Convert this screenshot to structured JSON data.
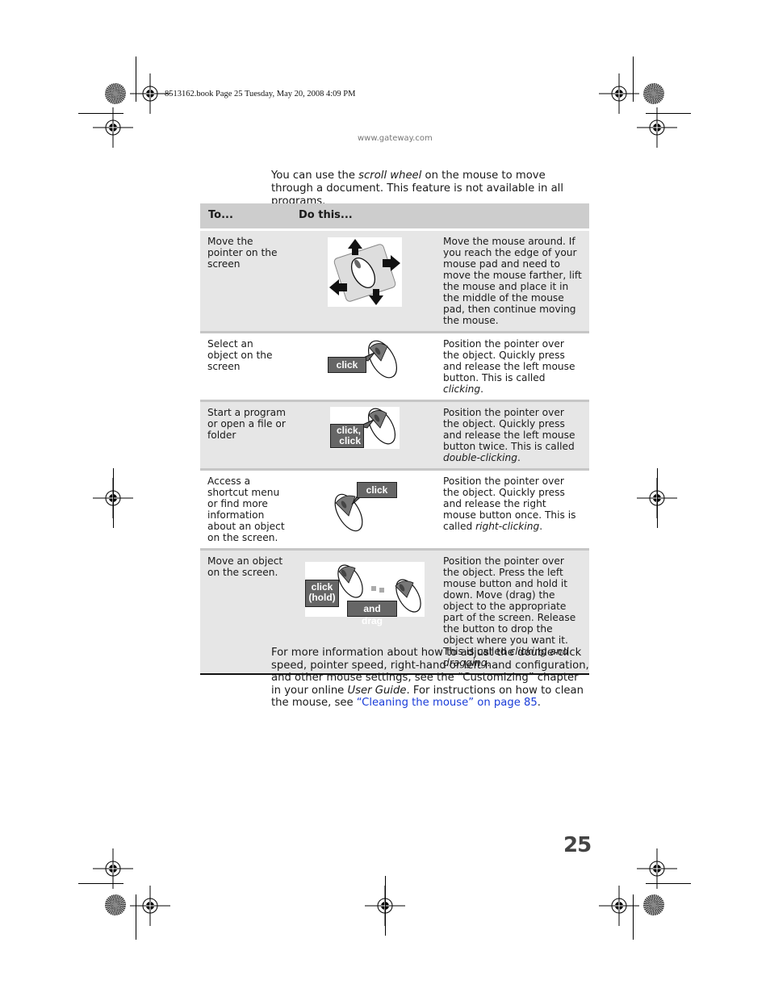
{
  "header": {
    "slug": "8513162.book  Page 25  Tuesday, May 20, 2008  4:09 PM",
    "website": "www.gateway.com"
  },
  "intro": {
    "before": "You can use the ",
    "emphasis": "scroll wheel",
    "after": " on the mouse to move through a document. This feature is not available in all programs."
  },
  "table": {
    "headers": [
      "To...",
      "Do this..."
    ],
    "rows": [
      {
        "to": "Move the pointer on the screen",
        "illustration": "mouse-on-pad-with-arrows",
        "desc_before": "Move the mouse around. If you reach the edge of your mouse pad and need to move the mouse farther, lift the mouse and place it in the middle of the mouse pad, then continue moving the mouse.",
        "desc_em": "",
        "desc_after": ""
      },
      {
        "to": "Select an object on the screen",
        "illustration": "mouse-left-click",
        "tag": "click",
        "desc_before": "Position the pointer over the object. Quickly press and release the left mouse button. This is called ",
        "desc_em": "clicking",
        "desc_after": "."
      },
      {
        "to": "Start a program or open a file or folder",
        "illustration": "mouse-double-click",
        "tag_line1": "click,",
        "tag_line2": "click",
        "desc_before": "Position the pointer over the object. Quickly press and release the left mouse button twice. This is called ",
        "desc_em": "double-clicking",
        "desc_after": "."
      },
      {
        "to": "Access a shortcut menu or find more information about an object on the screen.",
        "illustration": "mouse-right-click",
        "tag": "click",
        "desc_before": "Position the pointer over the object. Quickly press and release the right mouse button once. This is called ",
        "desc_em": "right-clicking",
        "desc_after": "."
      },
      {
        "to": "Move an object on the screen.",
        "illustration": "mouse-click-and-drag",
        "tag_line1": "click",
        "tag_line2": "(hold)",
        "tag2": "and drag",
        "desc_before": "Position the pointer over the object. Press the left mouse button and hold it down. Move (drag) the object to the appropriate part of the screen. Release the button to drop the object where you want it. This is called ",
        "desc_em": "clicking and dragging",
        "desc_after": "."
      }
    ]
  },
  "outro": {
    "text1": "For more information about how to adjust the double-click speed, pointer speed, right-hand or left-hand configuration, and other mouse settings, see the “Customizing” chapter in your online ",
    "emphasis": "User Guide",
    "text2": ". For instructions on how to clean the mouse, see ",
    "link": "“Cleaning the mouse” on page 85",
    "text3": "."
  },
  "page_number": "25",
  "colors": {
    "header_bg": "#cdcdcd",
    "shaded_row": "#e6e6e6",
    "link": "#1a3cd8",
    "tag_bg": "#666666"
  }
}
